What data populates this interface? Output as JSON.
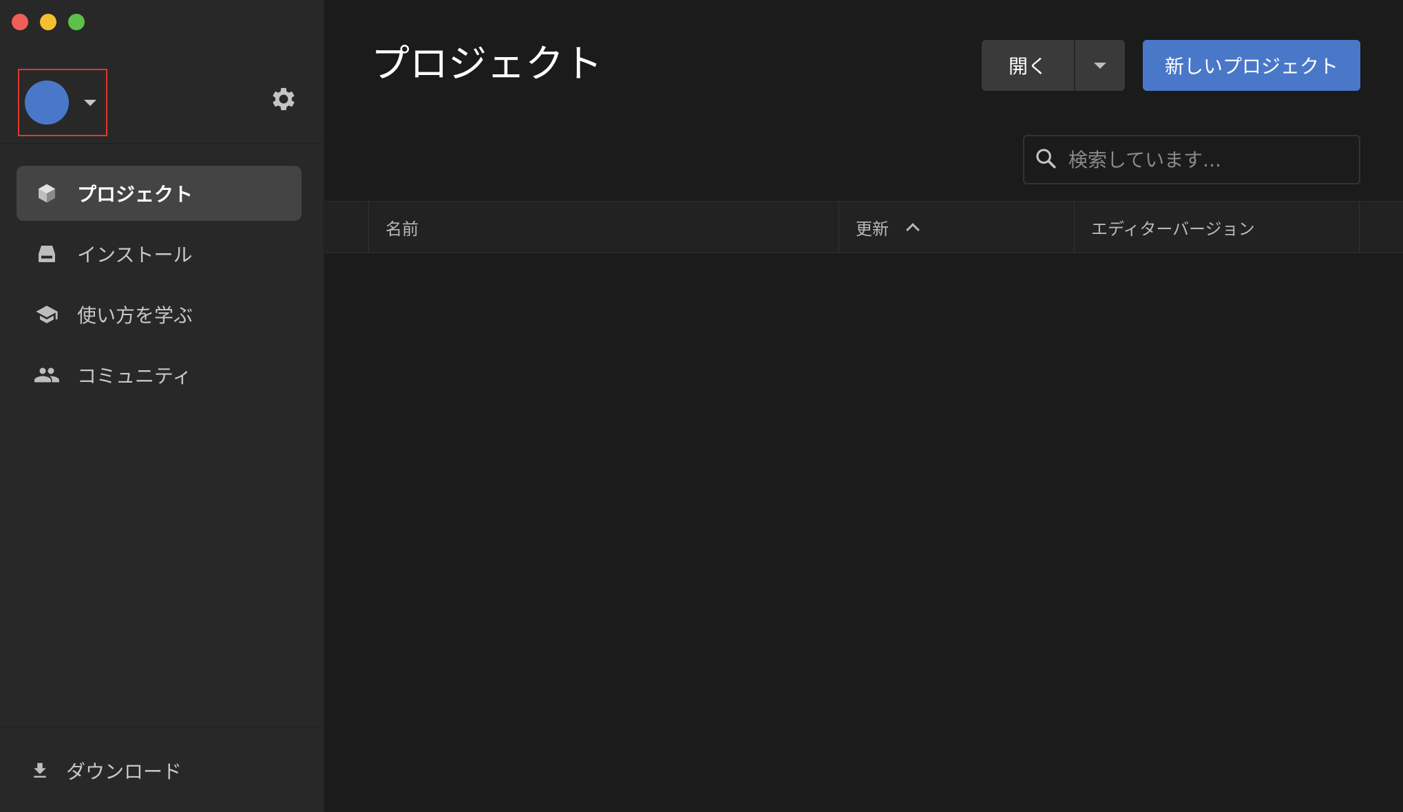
{
  "window": {
    "controls": [
      "close",
      "minimize",
      "maximize"
    ]
  },
  "sidebar": {
    "account": {
      "avatar_color": "#4a78c9",
      "icon": "chevron-down-icon"
    },
    "settings_icon": "gear-icon",
    "items": [
      {
        "label": "プロジェクト",
        "icon": "cube-icon",
        "active": true
      },
      {
        "label": "インストール",
        "icon": "drive-icon",
        "active": false
      },
      {
        "label": "使い方を学ぶ",
        "icon": "graduation-cap-icon",
        "active": false
      },
      {
        "label": "コミュニティ",
        "icon": "people-icon",
        "active": false
      }
    ],
    "download": {
      "label": "ダウンロード",
      "icon": "download-icon"
    }
  },
  "main": {
    "title": "プロジェクト",
    "open_button": "開く",
    "new_project_button": "新しいプロジェクト",
    "search": {
      "placeholder": "検索しています..."
    },
    "table": {
      "columns": [
        "名前",
        "更新",
        "エディターバージョン"
      ],
      "sort": {
        "column": "更新",
        "direction": "ascending"
      },
      "rows": []
    }
  },
  "colors": {
    "accent": "#4a78c9",
    "sidebar_bg": "#282828",
    "main_bg": "#1b1b1b",
    "highlight_border": "#e0392b"
  }
}
